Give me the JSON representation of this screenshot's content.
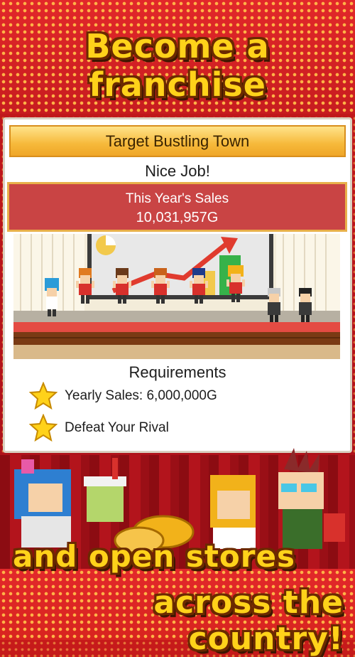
{
  "promo": {
    "headline_top": "Become a franchise",
    "headline_mid": "and open stores",
    "headline_bottom": "across the country!"
  },
  "dialog": {
    "title": "Target Bustling Town",
    "status": "Nice Job!",
    "sales_label": "This Year's Sales",
    "sales_value": "10,031,957G",
    "requirements_title": "Requirements",
    "requirements": [
      {
        "icon": "star-icon",
        "text": "Yearly Sales: 6,000,000G"
      },
      {
        "icon": "star-icon",
        "text": "Defeat Your Rival"
      }
    ]
  },
  "colors": {
    "background_red": "#c61a1a",
    "headline_yellow": "#ffd21a",
    "header_gold": "#f6b93a",
    "sales_red": "#c94444",
    "star_yellow": "#ffd21a"
  }
}
